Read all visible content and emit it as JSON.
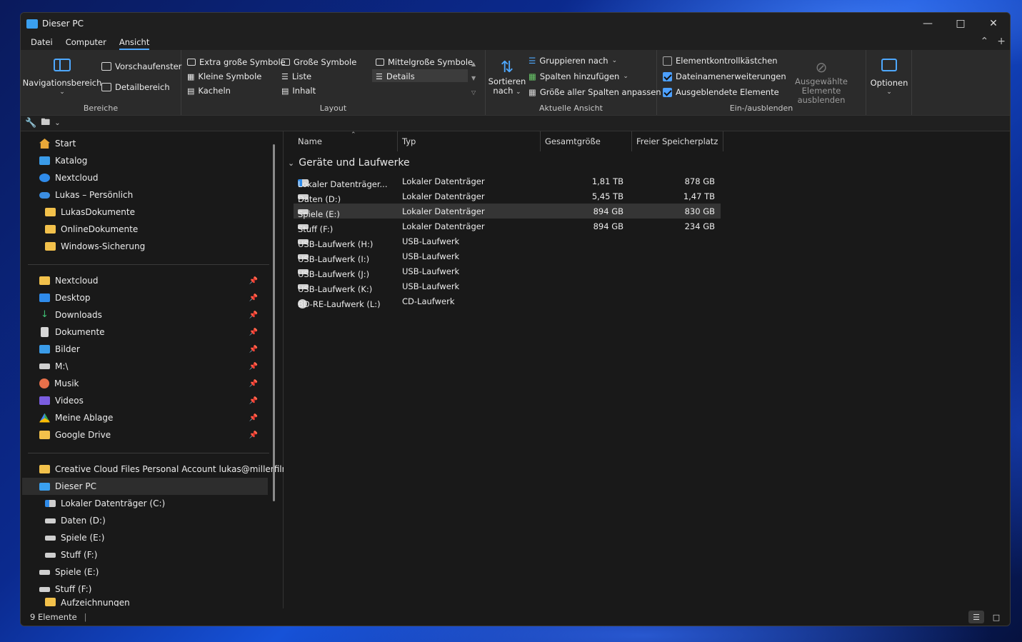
{
  "window": {
    "title": "Dieser PC"
  },
  "menu": {
    "items": [
      "Datei",
      "Computer",
      "Ansicht"
    ],
    "active": "Ansicht"
  },
  "ribbon": {
    "bereiche": {
      "label": "Bereiche",
      "navigationsbereich": "Navigationsbereich",
      "vorschaufenster": "Vorschaufenster",
      "detailbereich": "Detailbereich"
    },
    "layout": {
      "label": "Layout",
      "extra_gross": "Extra große Symbole",
      "gross": "Große Symbole",
      "mittelgross": "Mittelgroße Symbole",
      "klein": "Kleine Symbole",
      "liste": "Liste",
      "details": "Details",
      "kacheln": "Kacheln",
      "inhalt": "Inhalt"
    },
    "aktuelle_ansicht": {
      "label": "Aktuelle Ansicht",
      "sortieren_1": "Sortieren",
      "sortieren_2": "nach",
      "gruppieren": "Gruppieren nach",
      "spalten": "Spalten hinzufügen",
      "groesse": "Größe aller Spalten anpassen"
    },
    "ein_ausblenden": {
      "label": "Ein-/ausblenden",
      "elementkontroll": "Elementkontrollkästchen",
      "elementkontroll_checked": false,
      "dateinamen": "Dateinamenerweiterungen",
      "dateinamen_checked": true,
      "ausgeblendete": "Ausgeblendete Elemente",
      "ausgeblendete_checked": true,
      "ausgewaehlte_1": "Ausgewählte",
      "ausgewaehlte_2": "Elemente ausblenden"
    },
    "optionen": {
      "label": "Optionen"
    }
  },
  "nav": {
    "items": [
      {
        "label": "Start",
        "icon": "home-icon"
      },
      {
        "label": "Katalog",
        "icon": "gallery-icon"
      },
      {
        "label": "Nextcloud",
        "icon": "nextcloud-icon"
      },
      {
        "label": "Lukas – Persönlich",
        "icon": "onedrive-icon"
      },
      {
        "label": "LukasDokumente",
        "icon": "folder-icon"
      },
      {
        "label": "OnlineDokumente",
        "icon": "folder-icon"
      },
      {
        "label": "Windows-Sicherung",
        "icon": "folder-icon"
      },
      {
        "label": "Nextcloud",
        "icon": "folder-icon"
      },
      {
        "label": "Desktop",
        "icon": "desktop-icon"
      },
      {
        "label": "Downloads",
        "icon": "download-icon"
      },
      {
        "label": "Dokumente",
        "icon": "document-icon"
      },
      {
        "label": "Bilder",
        "icon": "pictures-icon"
      },
      {
        "label": "M:\\",
        "icon": "network-drive-icon"
      },
      {
        "label": "Musik",
        "icon": "music-icon"
      },
      {
        "label": "Videos",
        "icon": "video-icon"
      },
      {
        "label": "Meine Ablage",
        "icon": "google-drive-icon"
      },
      {
        "label": "Google Drive",
        "icon": "folder-icon"
      },
      {
        "label": "Creative Cloud Files Personal Account lukas@millerfilme.",
        "icon": "folder-icon"
      },
      {
        "label": "Dieser PC",
        "icon": "this-pc-icon"
      },
      {
        "label": "Lokaler Datenträger (C:)",
        "icon": "system-drive-icon"
      },
      {
        "label": "Daten (D:)",
        "icon": "drive-icon"
      },
      {
        "label": "Spiele (E:)",
        "icon": "drive-icon"
      },
      {
        "label": "Stuff (F:)",
        "icon": "drive-icon"
      },
      {
        "label": "Spiele (E:)",
        "icon": "drive-icon"
      },
      {
        "label": "Stuff (F:)",
        "icon": "drive-icon"
      },
      {
        "label": "Aufzeichnungen",
        "icon": "folder-icon"
      }
    ]
  },
  "columns": {
    "name": "Name",
    "typ": "Typ",
    "gesamt": "Gesamtgröße",
    "frei": "Freier Speicherplatz"
  },
  "group_header": "Geräte und Laufwerke",
  "rows": [
    {
      "name": "Lokaler Datenträger...",
      "typ": "Lokaler Datenträger",
      "gesamt": "1,81 TB",
      "frei": "878 GB"
    },
    {
      "name": "Daten (D:)",
      "typ": "Lokaler Datenträger",
      "gesamt": "5,45 TB",
      "frei": "1,47 TB"
    },
    {
      "name": "Spiele (E:)",
      "typ": "Lokaler Datenträger",
      "gesamt": "894 GB",
      "frei": "830 GB"
    },
    {
      "name": "Stuff (F:)",
      "typ": "Lokaler Datenträger",
      "gesamt": "894 GB",
      "frei": "234 GB"
    },
    {
      "name": "USB-Laufwerk (H:)",
      "typ": "USB-Laufwerk",
      "gesamt": "",
      "frei": ""
    },
    {
      "name": "USB-Laufwerk (I:)",
      "typ": "USB-Laufwerk",
      "gesamt": "",
      "frei": ""
    },
    {
      "name": "USB-Laufwerk (J:)",
      "typ": "USB-Laufwerk",
      "gesamt": "",
      "frei": ""
    },
    {
      "name": "USB-Laufwerk (K:)",
      "typ": "USB-Laufwerk",
      "gesamt": "",
      "frei": ""
    },
    {
      "name": "BD-RE-Laufwerk (L:)",
      "typ": "CD-Laufwerk",
      "gesamt": "",
      "frei": ""
    }
  ],
  "status": {
    "count": "9 Elemente"
  },
  "colors": {
    "accent": "#4ca0ff",
    "background": "#191919",
    "ribbon": "#2b2b2b"
  }
}
